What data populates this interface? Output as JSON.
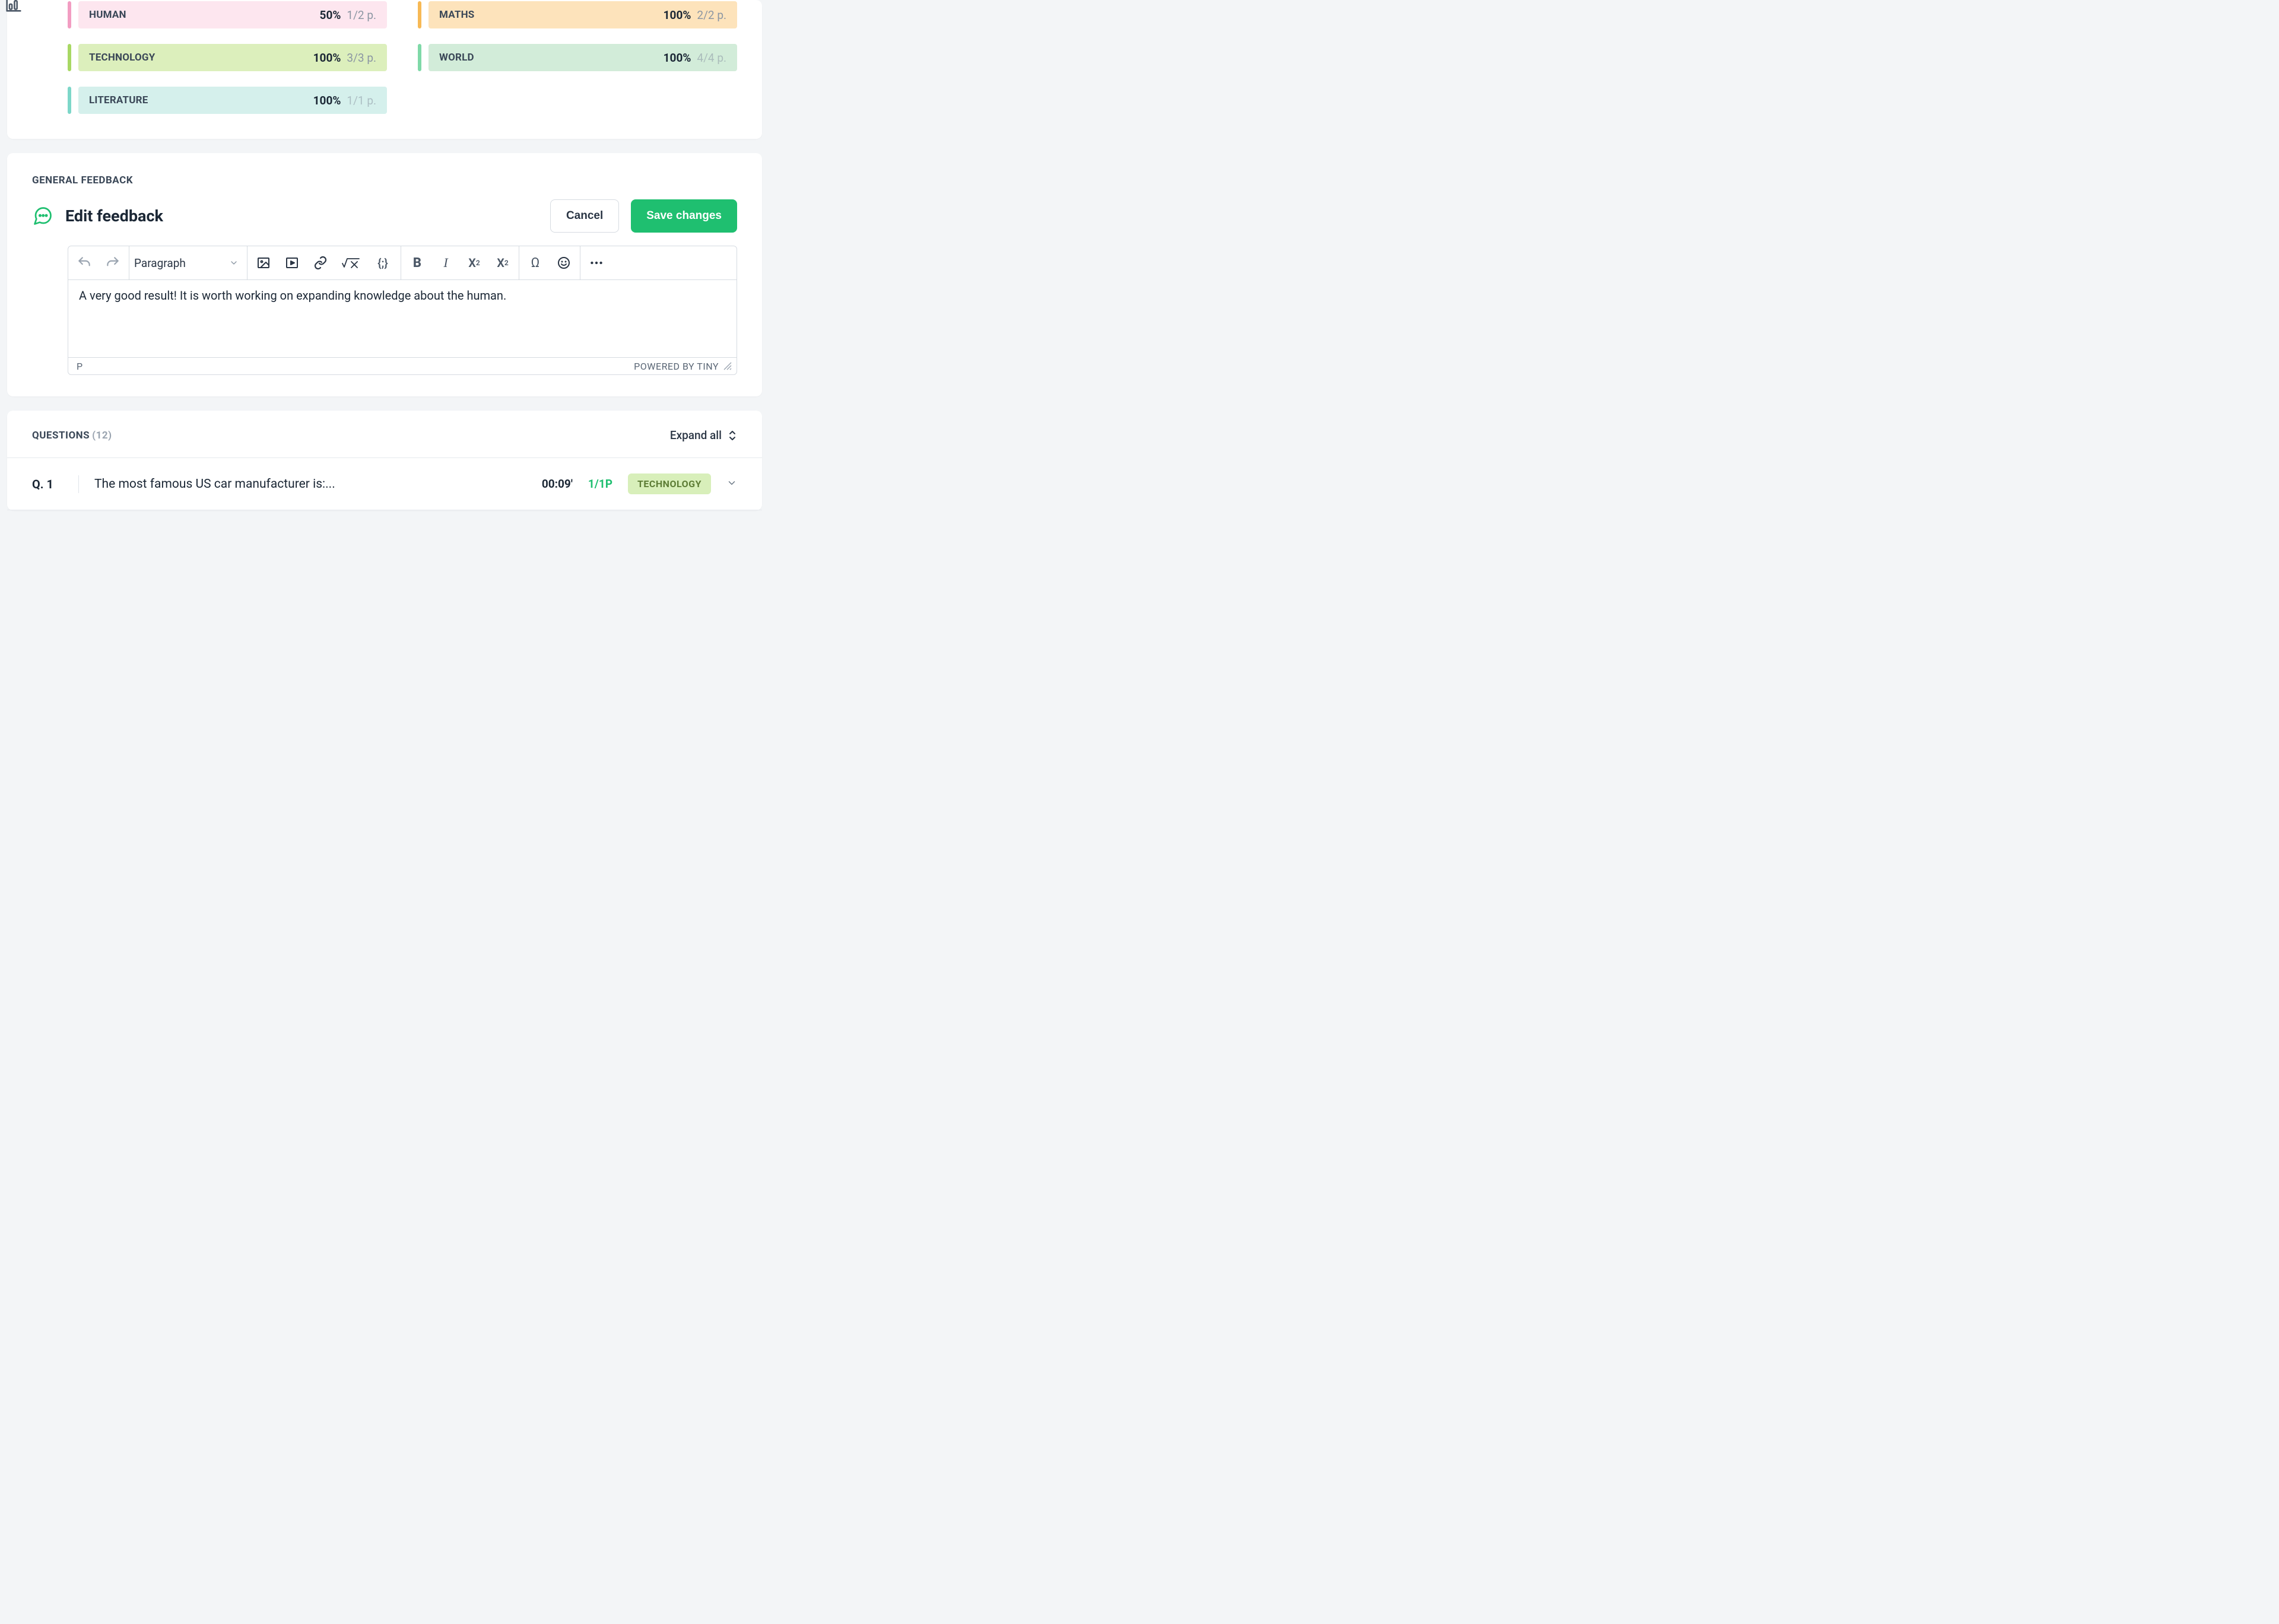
{
  "categories": [
    {
      "name": "HUMAN",
      "pct": "50%",
      "pts": "1/2 p.",
      "accent": "#f29dc2",
      "bg": "#fde6ef",
      "nameColor": "#3a4757",
      "faded": false
    },
    {
      "name": "MATHS",
      "pct": "100%",
      "pts": "2/2 p.",
      "accent": "#f7b955",
      "bg": "#fde3bb",
      "nameColor": "#3a4757",
      "faded": false
    },
    {
      "name": "TECHNOLOGY",
      "pct": "100%",
      "pts": "3/3 p.",
      "accent": "#a8d864",
      "bg": "#dcefbc",
      "nameColor": "#3a4757",
      "faded": false
    },
    {
      "name": "WORLD",
      "pct": "100%",
      "pts": "4/4 p.",
      "accent": "#7fd9a8",
      "bg": "#d2ecd9",
      "nameColor": "#3a4757",
      "faded": true
    },
    {
      "name": "LITERATURE",
      "pct": "100%",
      "pts": "1/1 p.",
      "accent": "#7dd7c9",
      "bg": "#d5f0ec",
      "nameColor": "#3a4757",
      "faded": true
    }
  ],
  "feedback": {
    "sectionLabel": "GENERAL FEEDBACK",
    "editTitle": "Edit feedback",
    "cancel": "Cancel",
    "save": "Save changes",
    "formatSelected": "Paragraph",
    "content": "A very good result! It is worth working on expanding knowledge about the human.",
    "statusPath": "P",
    "poweredBy": "POWERED BY TINY"
  },
  "questions": {
    "label": "QUESTIONS",
    "count": "(12)",
    "expandAll": "Expand all",
    "items": [
      {
        "num": "Q. 1",
        "text": "The most famous US car manufacturer is:...",
        "time": "00:09'",
        "pts": "1/1P",
        "tag": "TECHNOLOGY"
      }
    ]
  }
}
